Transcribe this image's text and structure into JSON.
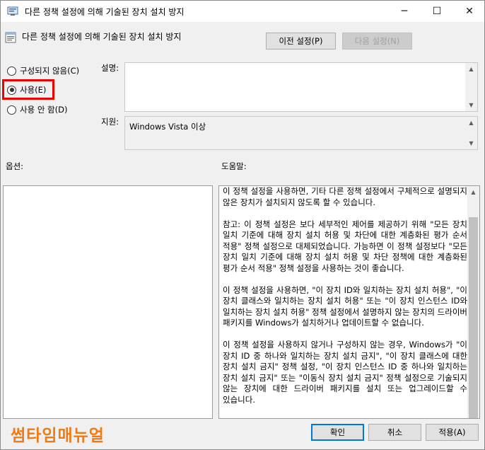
{
  "window": {
    "title": "다른 정책 설정에 의해 기술된 장치 설치 방지",
    "minimize_label": "─",
    "maximize_label": "☐",
    "close_label": "✕"
  },
  "header": {
    "policy_title": "다른 정책 설정에 의해 기술된 장치 설치 방지",
    "prev_button": "이전 설정(P)",
    "next_button": "다음 설정(N)"
  },
  "state": {
    "options": [
      {
        "label": "구성되지 않음(C)",
        "selected": false
      },
      {
        "label": "사용(E)",
        "selected": true
      },
      {
        "label": "사용 안 함(D)",
        "selected": false
      }
    ]
  },
  "comment": {
    "label": "설명:",
    "value": ""
  },
  "supported": {
    "label": "지원:",
    "value": "Windows Vista 이상"
  },
  "options_section": {
    "label": "옵션:"
  },
  "help_section": {
    "label": "도움말:",
    "paragraphs": [
      "이 정책 설정을 사용하면, 기타 다른 정책 설정에서 구체적으로 설명되지 않은 장치가 설치되지 않도록 할 수 있습니다.",
      "참고: 이 정책 설정은 보다 세부적인 제어를 제공하기 위해 \"모든 장치 일치 기준에 대해 장치 설치 허용 및 차단에 대한 계층화된 평가 순서 적용\" 정책 설정으로 대체되었습니다. 가능하면 이 정책 설정보다 \"모든 장치 일치 기준에 대해 장치 설치 허용 및 차단 정책에 대한 계층화된 평가 순서 적용\" 정책 설정을 사용하는 것이 좋습니다.",
      "이 정책 설정을 사용하면, \"이 장치 ID와 일치하는 장치 설치 허용\", \"이 장치 클래스와 일치하는 장치 설치 허용\" 또는 \"이 장치 인스턴스 ID와 일치하는 장치 설치 허용\" 정책 설정에서 설명하지 않는 장치의 드라이버 패키지를 Windows가 설치하거나 업데이트할 수 없습니다.",
      "이 정책 설정을 사용하지 않거나 구성하지 않는 경우, Windows가 \"이 장치 ID 중 하나와 일치하는 장치 설치 금지\", \"이 장치 클래스에 대한 장치 설치 금지\" 정책 설정, \"이 장치 인스턴스 ID 중 하나와 일치하는 장치 설치 금지\" 또는 \"이동식 장치 설치 금지\" 정책 설정으로 기술되지 않는 장치에 대한 드라이버 패키지를 설치 또는 업그레이드할 수 있습니다."
    ]
  },
  "footer": {
    "brand_logo": "썸타임매뉴얼",
    "ok_button": "확인",
    "cancel_button": "취소",
    "apply_button": "적용(A)"
  }
}
